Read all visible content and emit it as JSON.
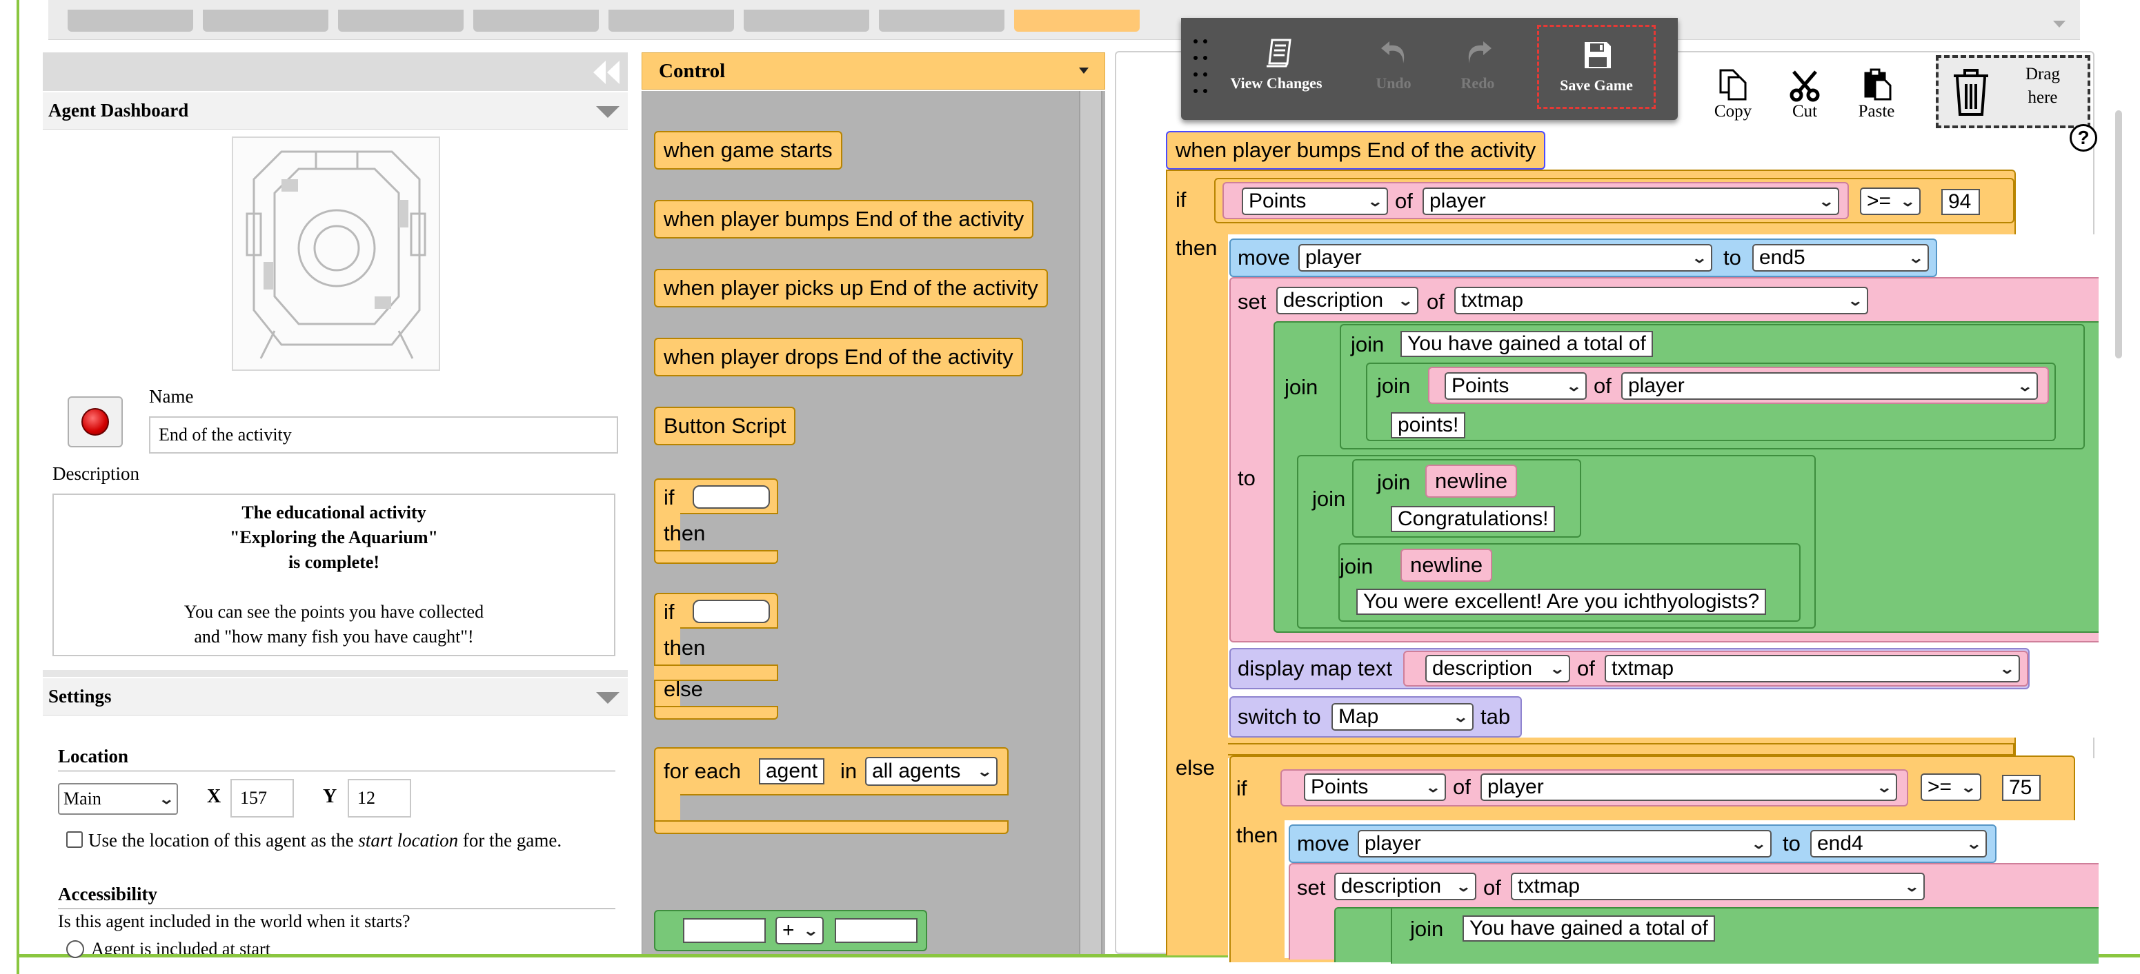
{
  "top_tabs_count": 8,
  "sidebar": {
    "agent_dashboard_title": "Agent Dashboard",
    "name_label": "Name",
    "name_value": "End of the activity",
    "description_label": "Description",
    "description_lines": [
      "The educational activity",
      "\"Exploring the Aquarium\"",
      "is complete!",
      "",
      "You can see the points you have collected",
      "and \"how many fish you have caught\"!"
    ],
    "settings_title": "Settings",
    "location_label": "Location",
    "location_select": "Main",
    "x_label": "X",
    "x_value": "157",
    "y_label": "Y",
    "y_value": "12",
    "start_location_text_before": "Use the location of this agent as the ",
    "start_location_text_em": "start location",
    "start_location_text_after": " for the game.",
    "accessibility_label": "Accessibility",
    "accessibility_question": "Is this agent included in the world when it starts?",
    "accessibility_option": "Agent is included at start"
  },
  "palette": {
    "category": "Control",
    "blocks": {
      "when_game_starts": "when game starts",
      "when_bumps": "when player bumps End of the activity",
      "when_picks_up": "when player picks up End of the activity",
      "when_drops": "when player drops End of the activity",
      "button_script": "Button Script",
      "if": "if",
      "then": "then",
      "else": "else",
      "for_each": "for each",
      "agent": "agent",
      "in": "in",
      "all_agents": "all agents",
      "plus": "+"
    }
  },
  "toolbar": {
    "view_changes": "View Changes",
    "undo": "Undo",
    "redo": "Redo",
    "save_game": "Save Game",
    "copy": "Copy",
    "cut": "Cut",
    "paste": "Paste",
    "drag_here_line1": "Drag",
    "drag_here_line2": "here",
    "help": "?"
  },
  "script": {
    "event": "when player bumps End of the activity",
    "kw_if": "if",
    "kw_then": "then",
    "kw_else": "else",
    "kw_of": "of",
    "kw_to": "to",
    "kw_set": "set",
    "kw_join": "join",
    "kw_move": "move",
    "points": "Points",
    "player": "player",
    "op_ge": ">=",
    "threshold1": "94",
    "threshold2": "75",
    "target1": "end5",
    "target2": "end4",
    "description": "description",
    "txtmap": "txtmap",
    "text_gained": "You have gained a total of",
    "text_points": "points!",
    "newline": "newline",
    "text_congrats": "Congratulations!",
    "text_excellent": "You were excellent! Are you ichthyologists?",
    "display_map_text": "display map text",
    "switch_to": "switch to",
    "tab_select": "Map",
    "tab_word": "tab"
  },
  "colors": {
    "control_yellow": "#ffcc70",
    "text_green": "#78c878",
    "variable_pink": "#f9bcd0",
    "motion_blue": "#a9d6f7",
    "looks_purple": "#cdc6f5",
    "frame_green": "#8ac640",
    "save_highlight": "#e53935"
  }
}
